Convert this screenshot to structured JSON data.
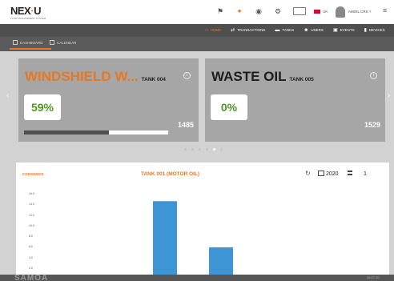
{
  "app": {
    "logo_main": "NEX",
    "logo_dot": "·",
    "logo_end": "U",
    "logo_tagline": "FLUID MANAGEMENT SYSTEM"
  },
  "header": {
    "lang": "UK",
    "user": "AMOIL CRS",
    "icons": [
      "flag-icon",
      "rocket-icon",
      "location-pin-icon",
      "gear-icon",
      "keyboard-icon",
      "menu-icon"
    ]
  },
  "nav": {
    "items": [
      {
        "label": "HOME",
        "icon": "home-icon",
        "active": true
      },
      {
        "label": "TRANSACTIONS",
        "icon": "transactions-icon",
        "active": false
      },
      {
        "label": "TANKS",
        "icon": "tanks-icon",
        "active": false
      },
      {
        "label": "USERS",
        "icon": "users-icon",
        "active": false
      },
      {
        "label": "EVENTS",
        "icon": "events-icon",
        "active": false
      },
      {
        "label": "DEVICES",
        "icon": "devices-icon",
        "active": false
      }
    ]
  },
  "subtabs": {
    "dashboard": "DASHBOARD",
    "calendar": "CALENDAR"
  },
  "cards": [
    {
      "title": "WINDSHIELD W...",
      "tank": "TANK 004",
      "percent_label": "59%",
      "level_fraction": 0.59,
      "number": "1485"
    },
    {
      "title": "WASTE OIL",
      "tank": "TANK 005",
      "percent_label": "0%",
      "level_fraction": 0,
      "number": "1529"
    }
  ],
  "carousel": {
    "count": 6,
    "active": 4
  },
  "panel": {
    "left_label": "CONSUMOS",
    "title": "TANK 001 (MOTOR OIL)",
    "year": "2020",
    "selector": "1"
  },
  "chart_data": {
    "type": "bar",
    "title": "TANK 001 (MOTOR OIL)",
    "y_ticks": [
      "16.0",
      "14.0",
      "12.0",
      "10.0",
      "8.0",
      "6.0",
      "4.0",
      "2.0"
    ],
    "series": [
      {
        "values": [
          14.6,
          5.9
        ]
      }
    ],
    "color": "#3d95d6"
  },
  "footer": {
    "brand": "SAMOA",
    "right": "26.07.20"
  }
}
